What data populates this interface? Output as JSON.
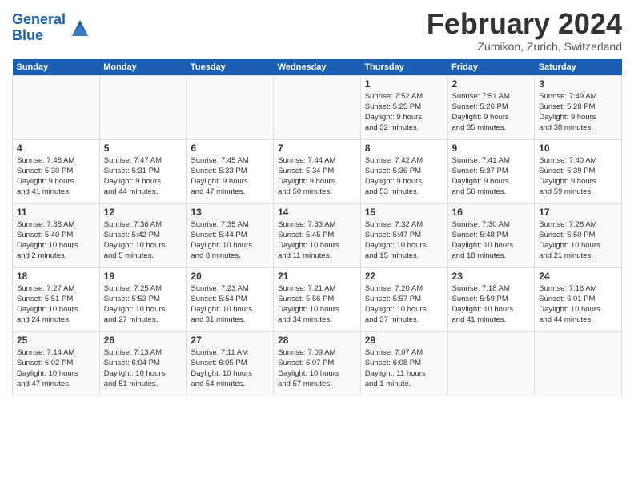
{
  "header": {
    "logo_line1": "General",
    "logo_line2": "Blue",
    "month_title": "February 2024",
    "location": "Zumikon, Zurich, Switzerland"
  },
  "days_of_week": [
    "Sunday",
    "Monday",
    "Tuesday",
    "Wednesday",
    "Thursday",
    "Friday",
    "Saturday"
  ],
  "weeks": [
    [
      {
        "day": "",
        "info": ""
      },
      {
        "day": "",
        "info": ""
      },
      {
        "day": "",
        "info": ""
      },
      {
        "day": "",
        "info": ""
      },
      {
        "day": "1",
        "info": "Sunrise: 7:52 AM\nSunset: 5:25 PM\nDaylight: 9 hours\nand 32 minutes."
      },
      {
        "day": "2",
        "info": "Sunrise: 7:51 AM\nSunset: 5:26 PM\nDaylight: 9 hours\nand 35 minutes."
      },
      {
        "day": "3",
        "info": "Sunrise: 7:49 AM\nSunset: 5:28 PM\nDaylight: 9 hours\nand 38 minutes."
      }
    ],
    [
      {
        "day": "4",
        "info": "Sunrise: 7:48 AM\nSunset: 5:30 PM\nDaylight: 9 hours\nand 41 minutes."
      },
      {
        "day": "5",
        "info": "Sunrise: 7:47 AM\nSunset: 5:31 PM\nDaylight: 9 hours\nand 44 minutes."
      },
      {
        "day": "6",
        "info": "Sunrise: 7:45 AM\nSunset: 5:33 PM\nDaylight: 9 hours\nand 47 minutes."
      },
      {
        "day": "7",
        "info": "Sunrise: 7:44 AM\nSunset: 5:34 PM\nDaylight: 9 hours\nand 50 minutes."
      },
      {
        "day": "8",
        "info": "Sunrise: 7:42 AM\nSunset: 5:36 PM\nDaylight: 9 hours\nand 53 minutes."
      },
      {
        "day": "9",
        "info": "Sunrise: 7:41 AM\nSunset: 5:37 PM\nDaylight: 9 hours\nand 56 minutes."
      },
      {
        "day": "10",
        "info": "Sunrise: 7:40 AM\nSunset: 5:39 PM\nDaylight: 9 hours\nand 59 minutes."
      }
    ],
    [
      {
        "day": "11",
        "info": "Sunrise: 7:38 AM\nSunset: 5:40 PM\nDaylight: 10 hours\nand 2 minutes."
      },
      {
        "day": "12",
        "info": "Sunrise: 7:36 AM\nSunset: 5:42 PM\nDaylight: 10 hours\nand 5 minutes."
      },
      {
        "day": "13",
        "info": "Sunrise: 7:35 AM\nSunset: 5:44 PM\nDaylight: 10 hours\nand 8 minutes."
      },
      {
        "day": "14",
        "info": "Sunrise: 7:33 AM\nSunset: 5:45 PM\nDaylight: 10 hours\nand 11 minutes."
      },
      {
        "day": "15",
        "info": "Sunrise: 7:32 AM\nSunset: 5:47 PM\nDaylight: 10 hours\nand 15 minutes."
      },
      {
        "day": "16",
        "info": "Sunrise: 7:30 AM\nSunset: 5:48 PM\nDaylight: 10 hours\nand 18 minutes."
      },
      {
        "day": "17",
        "info": "Sunrise: 7:28 AM\nSunset: 5:50 PM\nDaylight: 10 hours\nand 21 minutes."
      }
    ],
    [
      {
        "day": "18",
        "info": "Sunrise: 7:27 AM\nSunset: 5:51 PM\nDaylight: 10 hours\nand 24 minutes."
      },
      {
        "day": "19",
        "info": "Sunrise: 7:25 AM\nSunset: 5:53 PM\nDaylight: 10 hours\nand 27 minutes."
      },
      {
        "day": "20",
        "info": "Sunrise: 7:23 AM\nSunset: 5:54 PM\nDaylight: 10 hours\nand 31 minutes."
      },
      {
        "day": "21",
        "info": "Sunrise: 7:21 AM\nSunset: 5:56 PM\nDaylight: 10 hours\nand 34 minutes."
      },
      {
        "day": "22",
        "info": "Sunrise: 7:20 AM\nSunset: 5:57 PM\nDaylight: 10 hours\nand 37 minutes."
      },
      {
        "day": "23",
        "info": "Sunrise: 7:18 AM\nSunset: 5:59 PM\nDaylight: 10 hours\nand 41 minutes."
      },
      {
        "day": "24",
        "info": "Sunrise: 7:16 AM\nSunset: 6:01 PM\nDaylight: 10 hours\nand 44 minutes."
      }
    ],
    [
      {
        "day": "25",
        "info": "Sunrise: 7:14 AM\nSunset: 6:02 PM\nDaylight: 10 hours\nand 47 minutes."
      },
      {
        "day": "26",
        "info": "Sunrise: 7:13 AM\nSunset: 6:04 PM\nDaylight: 10 hours\nand 51 minutes."
      },
      {
        "day": "27",
        "info": "Sunrise: 7:11 AM\nSunset: 6:05 PM\nDaylight: 10 hours\nand 54 minutes."
      },
      {
        "day": "28",
        "info": "Sunrise: 7:09 AM\nSunset: 6:07 PM\nDaylight: 10 hours\nand 57 minutes."
      },
      {
        "day": "29",
        "info": "Sunrise: 7:07 AM\nSunset: 6:08 PM\nDaylight: 11 hours\nand 1 minute."
      },
      {
        "day": "",
        "info": ""
      },
      {
        "day": "",
        "info": ""
      }
    ]
  ]
}
